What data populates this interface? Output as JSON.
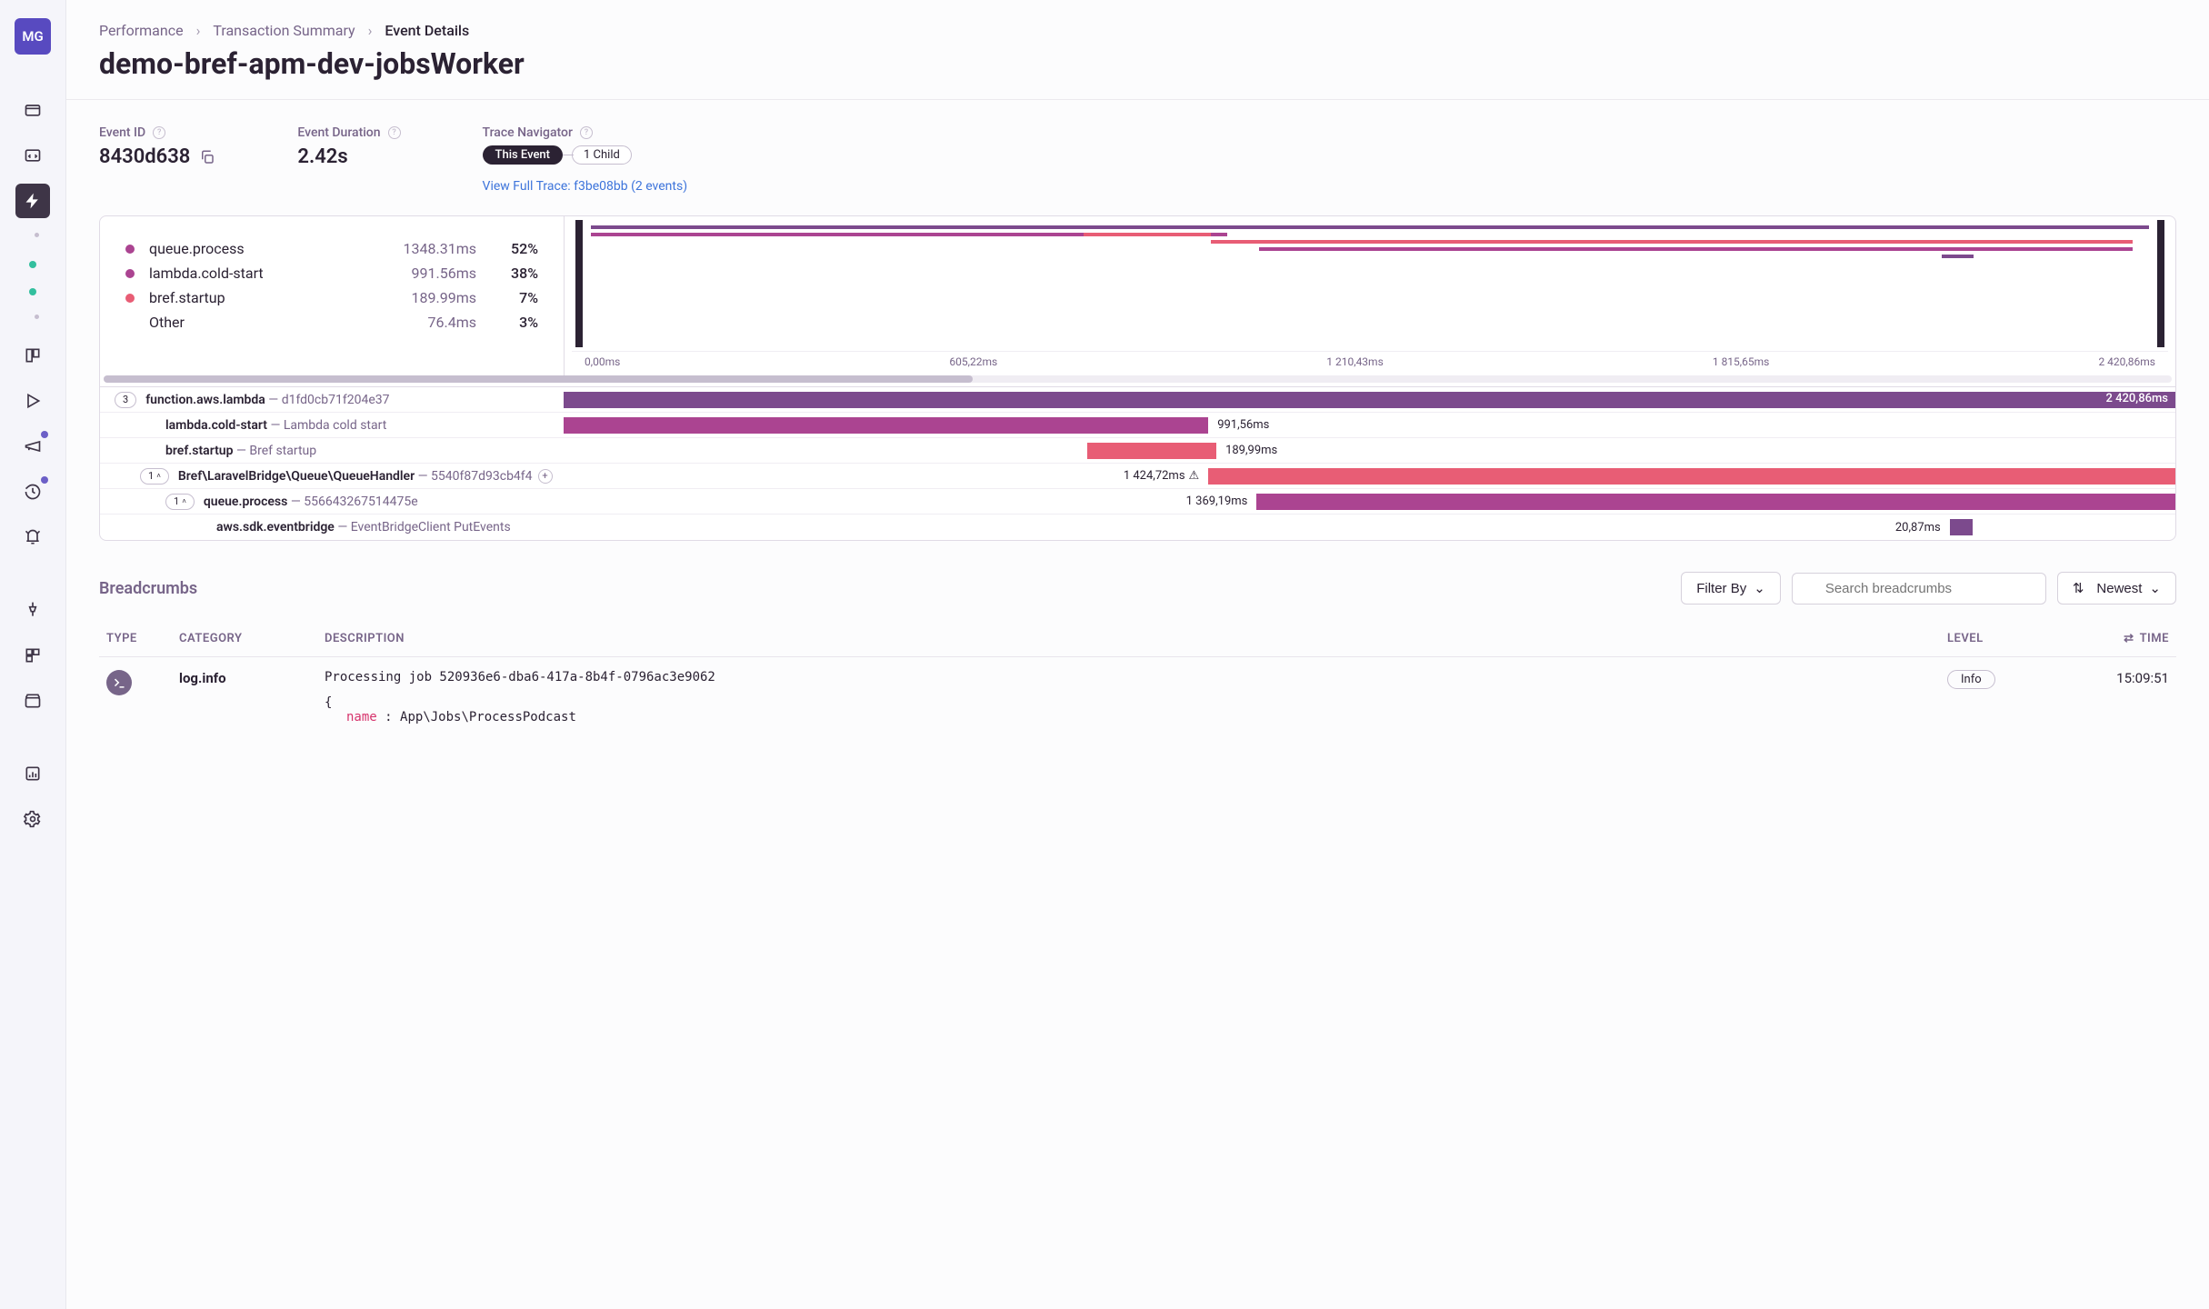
{
  "avatar": "MG",
  "breadcrumbs": {
    "items": [
      "Performance",
      "Transaction Summary",
      "Event Details"
    ]
  },
  "page_title": "demo-bref-apm-dev-jobsWorker",
  "meta": {
    "event_id_label": "Event ID",
    "event_id": "8430d638",
    "duration_label": "Event Duration",
    "duration": "2.42s",
    "trace_nav_label": "Trace Navigator",
    "this_event": "This Event",
    "child": "1 Child",
    "full_trace_link": "View Full Trace: f3be08bb (2 events)"
  },
  "operations": [
    {
      "color": "#ab4491",
      "name": "queue.process",
      "ms": "1348.31ms",
      "pct": "52%"
    },
    {
      "color": "#ab4491",
      "name": "lambda.cold-start",
      "ms": "991.56ms",
      "pct": "38%"
    },
    {
      "color": "#e85d75",
      "name": "bref.startup",
      "ms": "189.99ms",
      "pct": "7%"
    },
    {
      "color": "",
      "name": "Other",
      "ms": "76.4ms",
      "pct": "3%"
    }
  ],
  "time_axis": [
    "0,00ms",
    "605,22ms",
    "1 210,43ms",
    "1 815,65ms",
    "2 420,86ms"
  ],
  "spans": {
    "s0": {
      "badge": "3",
      "name": "function.aws.lambda",
      "desc": "d1fd0cb71f204e37",
      "time": "2 420,86ms"
    },
    "s1": {
      "name": "lambda.cold-start",
      "desc": "Lambda cold start",
      "time": "991,56ms"
    },
    "s2": {
      "name": "bref.startup",
      "desc": "Bref startup",
      "time": "189,99ms"
    },
    "s3": {
      "badge": "1",
      "name": "Bref\\LaravelBridge\\Queue\\QueueHandler",
      "desc": "5540f87d93cb4f4",
      "time": "1 424,72ms"
    },
    "s4": {
      "badge": "1",
      "name": "queue.process",
      "desc": "556643267514475e",
      "time": "1 369,19ms"
    },
    "s5": {
      "name": "aws.sdk.eventbridge",
      "desc": "EventBridgeClient PutEvents",
      "time": "20,87ms"
    }
  },
  "bc": {
    "title": "Breadcrumbs",
    "filter_by": "Filter By",
    "search_placeholder": "Search breadcrumbs",
    "newest": "Newest",
    "cols": {
      "type": "TYPE",
      "category": "CATEGORY",
      "description": "DESCRIPTION",
      "level": "LEVEL",
      "time": "TIME"
    },
    "row": {
      "category": "log.info",
      "desc": "Processing job 520936e6-dba6-417a-8b4f-0796ac3e9062",
      "json_open": "{",
      "json_key": "name",
      "json_sep": " : ",
      "json_val": "App\\Jobs\\ProcessPodcast",
      "level": "Info",
      "time": "15:09:51"
    }
  },
  "colors": {
    "purple_span": "#7c4a8d",
    "magenta_span": "#ab4491",
    "pink_span": "#e85d75"
  }
}
